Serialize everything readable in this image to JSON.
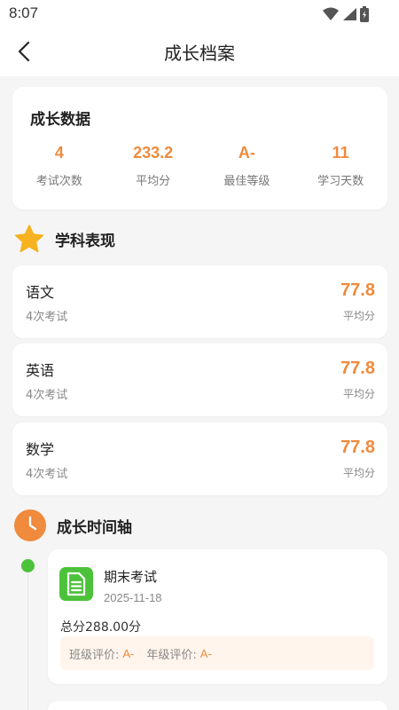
{
  "status_bar": {
    "time": "8:07"
  },
  "nav": {
    "title": "成长档案"
  },
  "growth_stats": {
    "title": "成长数据",
    "items": [
      {
        "value": "4",
        "label": "考试次数"
      },
      {
        "value": "233.2",
        "label": "平均分"
      },
      {
        "value": "A-",
        "label": "最佳等级"
      },
      {
        "value": "11",
        "label": "学习天数"
      }
    ]
  },
  "subjects_section": {
    "title": "学科表现"
  },
  "subjects": [
    {
      "name": "语文",
      "count": "4次考试",
      "score": "77.8",
      "score_label": "平均分"
    },
    {
      "name": "英语",
      "count": "4次考试",
      "score": "77.8",
      "score_label": "平均分"
    },
    {
      "name": "数学",
      "count": "4次考试",
      "score": "77.8",
      "score_label": "平均分"
    }
  ],
  "timeline_section": {
    "title": "成长时间轴"
  },
  "timeline": [
    {
      "title": "期末考试",
      "date": "2025-11-18",
      "total": "总分288.00分",
      "class_label": "班级评价:",
      "class_grade": "A-",
      "grade_label": "年级评价:",
      "grade_grade": "A-"
    }
  ],
  "colors": {
    "accent": "#f08a3c",
    "success": "#4cc23a",
    "background": "#f5f5f5",
    "card": "#ffffff"
  },
  "icons": {
    "back": "chevron-left-icon",
    "subjects": "star-icon",
    "timeline": "clock-icon",
    "exam": "document-icon",
    "wifi": "wifi-icon",
    "signal": "signal-icon",
    "battery": "battery-icon"
  }
}
